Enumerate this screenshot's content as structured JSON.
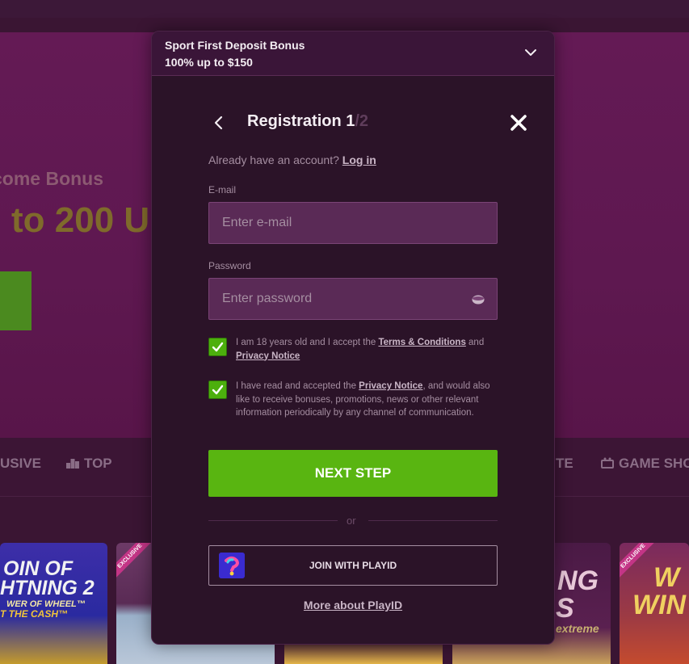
{
  "background": {
    "hero": {
      "bonus_text": "come Bonus",
      "amount_text": "to 200 U"
    },
    "nav": {
      "items": [
        {
          "label": "USIVE"
        },
        {
          "label": "TOP"
        },
        {
          "label": "TE"
        },
        {
          "label": "GAME SHOW"
        }
      ]
    },
    "games": [
      {
        "title_line1": "OIN OF",
        "title_line2": "HTNING 2",
        "subtitle": "WER OF WHEEL™",
        "tagline": "T THE CASH™"
      },
      {
        "ribbon": "EXCLUSIVE"
      },
      {
        "title_line1": "NG",
        "title_line2": "S",
        "subtitle": "extreme"
      },
      {
        "ribbon": "EXCLUSIVE",
        "title_line1": "W",
        "title_line2": "WIN"
      }
    ]
  },
  "promo": {
    "title": "Sport First Deposit Bonus",
    "subtitle": "100% up to $150",
    "icon": "chevron-down-icon"
  },
  "registration": {
    "title": "Registration",
    "step": "1",
    "total": "/2",
    "back_icon": "chevron-left-icon",
    "close_icon": "close-icon"
  },
  "account": {
    "prompt": "Already have an account?",
    "login_link": "Log in"
  },
  "email": {
    "label": "E-mail",
    "placeholder": "Enter e-mail",
    "value": ""
  },
  "password": {
    "label": "Password",
    "placeholder": "Enter password",
    "value": "",
    "toggle_icon": "eye-icon"
  },
  "consent_terms": {
    "checked": true,
    "text_before": "I am 18 years old and I accept the ",
    "terms_link": "Terms & Conditions",
    "text_middle": " and ",
    "privacy_link": "Privacy Notice"
  },
  "consent_marketing": {
    "checked": true,
    "text_before": "I have read and accepted the ",
    "privacy_link": "Privacy Notice",
    "text_after": ", and would also like to receive bonuses, promotions, news or other relevant information periodically by any channel of communication."
  },
  "next_button": "NEXT STEP",
  "divider_text": "or",
  "playid": {
    "label": "JOIN WITH PLAYID",
    "logo_icon": "playid-logo-icon",
    "more_link": "More about PlayID"
  },
  "colors": {
    "accent_green": "#59b511",
    "modal_bg": "#2b1328",
    "hero_bg": "#641a55",
    "input_bg": "#5a2a56"
  }
}
